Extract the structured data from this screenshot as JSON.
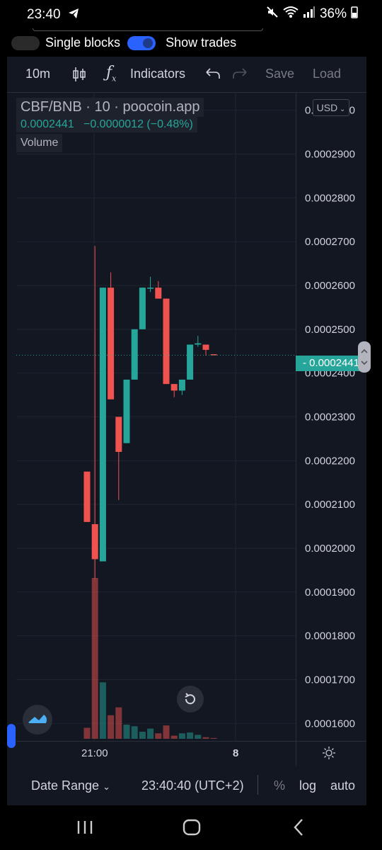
{
  "status": {
    "time": "23:40",
    "battery": "36%"
  },
  "toggles": {
    "single_blocks": "Single blocks",
    "show_trades": "Show trades"
  },
  "toolbar": {
    "interval": "10m",
    "indicators": "Indicators",
    "save": "Save",
    "load": "Load"
  },
  "legend": {
    "symbol": "CBF/BNB · 10 · poocoin.app",
    "price": "0.0002441",
    "change": "−0.0000012 (−0.48%)",
    "volume": "Volume"
  },
  "currency": "USD",
  "last_price_label": "0.0002441",
  "time_labels": [
    "21:00",
    "8"
  ],
  "bottom": {
    "date_range": "Date Range",
    "clock": "23:40:40 (UTC+2)",
    "percent": "%",
    "log": "log",
    "auto": "auto"
  },
  "chart_data": {
    "type": "candlestick",
    "ylim": [
      0.000156,
      0.000304
    ],
    "y_ticks": [
      "0.0003000",
      "0.0002900",
      "0.0002800",
      "0.0002700",
      "0.0002600",
      "0.0002500",
      "0.0002400",
      "0.0002300",
      "0.0002200",
      "0.0002100",
      "0.0002000",
      "0.0001900",
      "0.0001800",
      "0.0001700",
      "0.0001600"
    ],
    "last_price": 0.0002441,
    "candles": [
      {
        "o": 0.0002175,
        "h": 0.0002175,
        "l": 0.000206,
        "c": 0.000206
      },
      {
        "o": 0.0002055,
        "h": 0.000269,
        "l": 0.000193,
        "c": 0.0001975
      },
      {
        "o": 0.000197,
        "h": 0.0002595,
        "l": 0.000197,
        "c": 0.0002595
      },
      {
        "o": 0.0002595,
        "h": 0.000263,
        "l": 0.000234,
        "c": 0.000234
      },
      {
        "o": 0.00023,
        "h": 0.00023,
        "l": 0.000211,
        "c": 0.000222
      },
      {
        "o": 0.000224,
        "h": 0.0002385,
        "l": 0.000224,
        "c": 0.0002385
      },
      {
        "o": 0.0002385,
        "h": 0.00025,
        "l": 0.0002385,
        "c": 0.00025
      },
      {
        "o": 0.00025,
        "h": 0.0002595,
        "l": 0.00025,
        "c": 0.0002595
      },
      {
        "o": 0.0002595,
        "h": 0.000262,
        "l": 0.0002585,
        "c": 0.0002595
      },
      {
        "o": 0.0002595,
        "h": 0.000261,
        "l": 0.000257,
        "c": 0.000257
      },
      {
        "o": 0.000257,
        "h": 0.000257,
        "l": 0.0002375,
        "c": 0.0002375
      },
      {
        "o": 0.0002375,
        "h": 0.0002375,
        "l": 0.0002345,
        "c": 0.000236
      },
      {
        "o": 0.000236,
        "h": 0.0002385,
        "l": 0.000235,
        "c": 0.0002385
      },
      {
        "o": 0.0002385,
        "h": 0.0002465,
        "l": 0.0002385,
        "c": 0.0002465
      },
      {
        "o": 0.0002465,
        "h": 0.0002485,
        "l": 0.000246,
        "c": 0.0002468
      },
      {
        "o": 0.0002465,
        "h": 0.0002465,
        "l": 0.000244,
        "c": 0.0002453
      },
      {
        "o": 0.0002443,
        "h": 0.0002443,
        "l": 0.0002441,
        "c": 0.0002441
      }
    ],
    "volume": [
      14,
      205,
      72,
      30,
      40,
      18,
      16,
      9,
      13,
      7,
      17,
      4,
      7,
      8,
      5,
      2,
      1
    ]
  }
}
